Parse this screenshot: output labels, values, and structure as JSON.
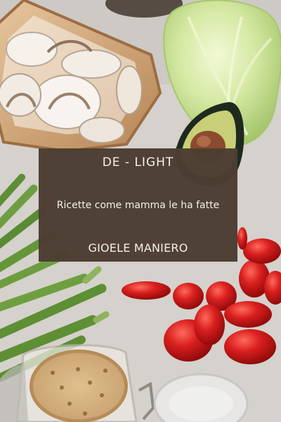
{
  "book": {
    "title": "DE - LIGHT",
    "subtitle": "Ricette come mamma le ha fatte",
    "author": "GIOELE MANIERO"
  },
  "colors": {
    "panel": "#4d3e32",
    "text": "#f4f0ea",
    "background": "#d8d4cf"
  }
}
